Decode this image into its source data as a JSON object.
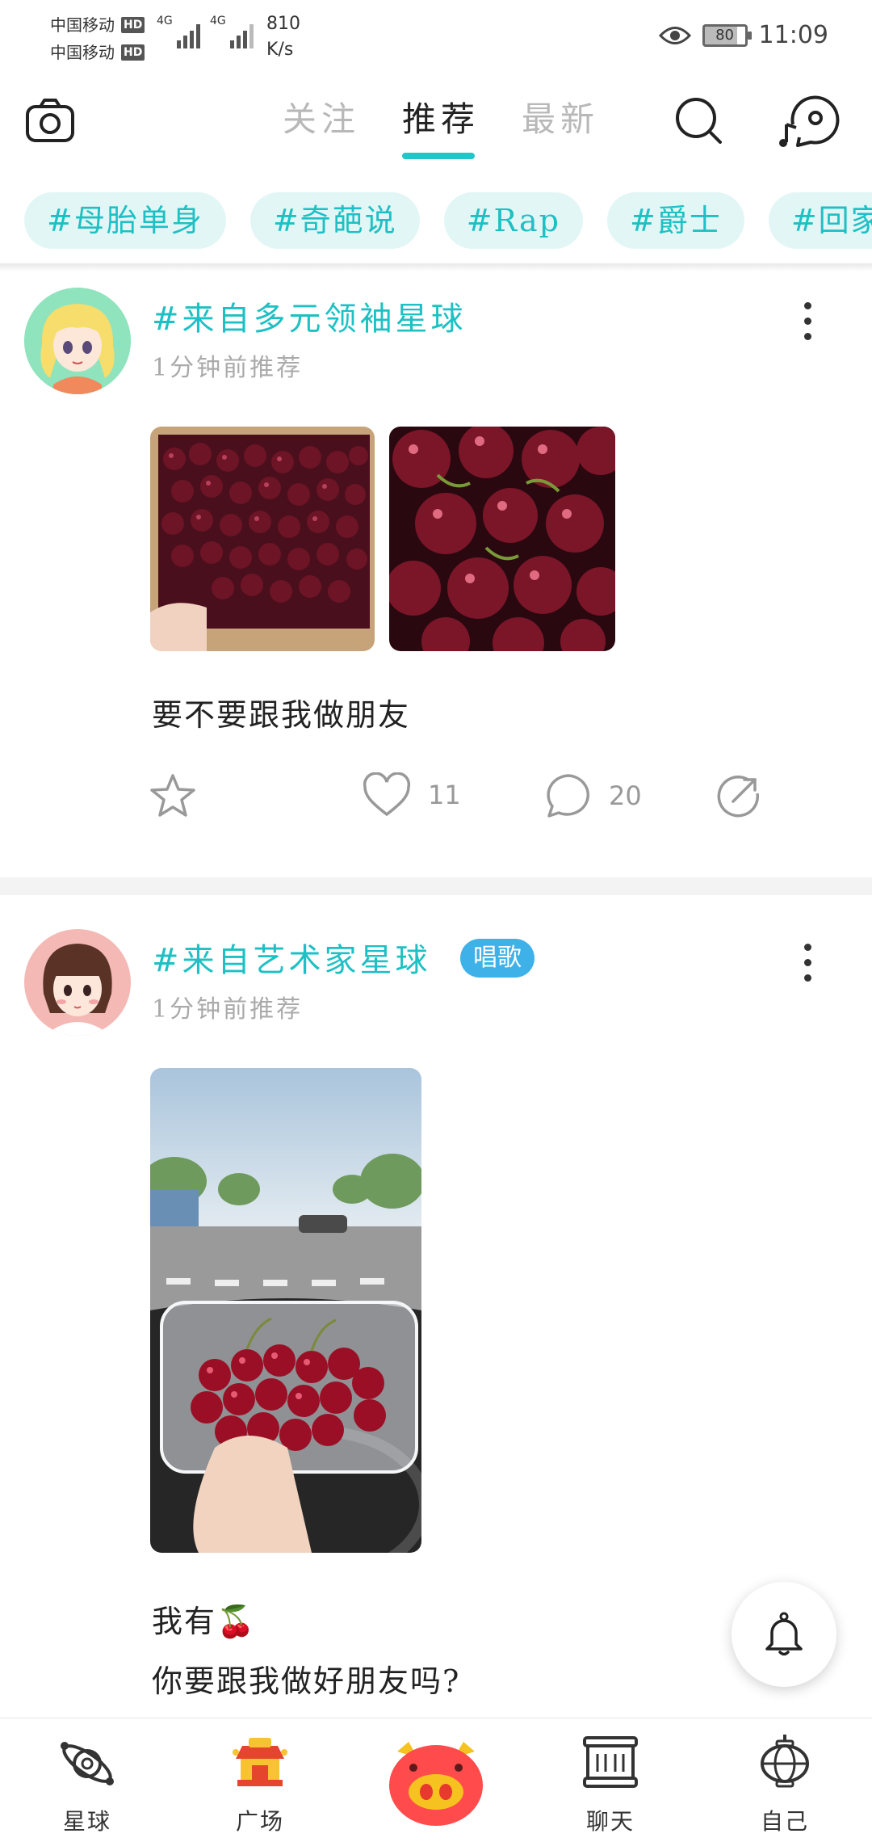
{
  "status_bar": {
    "carrier1": "中国移动",
    "carrier2": "中国移动",
    "hd": "HD",
    "net1": "4G",
    "net2": "4G",
    "speed_value": "810",
    "speed_unit": "K/s",
    "battery": "80",
    "time": "11:09"
  },
  "top_nav": {
    "tabs": [
      {
        "label": "关注",
        "active": false
      },
      {
        "label": "推荐",
        "active": true
      },
      {
        "label": "最新",
        "active": false
      }
    ]
  },
  "hashtags": [
    "#母胎单身",
    "#奇葩说",
    "#Rap",
    "#爵士",
    "#回家"
  ],
  "posts": [
    {
      "title": "#来自多元领袖星球",
      "time": "1分钟前推荐",
      "text": "要不要跟我做朋友",
      "likes": "11",
      "comments": "20"
    },
    {
      "title": "#来自艺术家星球",
      "badge": "唱歌",
      "time": "1分钟前推荐",
      "text_line1": "我有🍒",
      "text_line2": "你要跟我做好朋友吗?"
    }
  ],
  "bottom_nav": {
    "items": [
      {
        "label": "星球"
      },
      {
        "label": "广场"
      },
      {
        "label": "聊天"
      },
      {
        "label": "自己"
      }
    ]
  },
  "colors": {
    "accent": "#1ec0c4",
    "chip_bg": "#e3f6f6",
    "badge": "#3eb1e8"
  }
}
